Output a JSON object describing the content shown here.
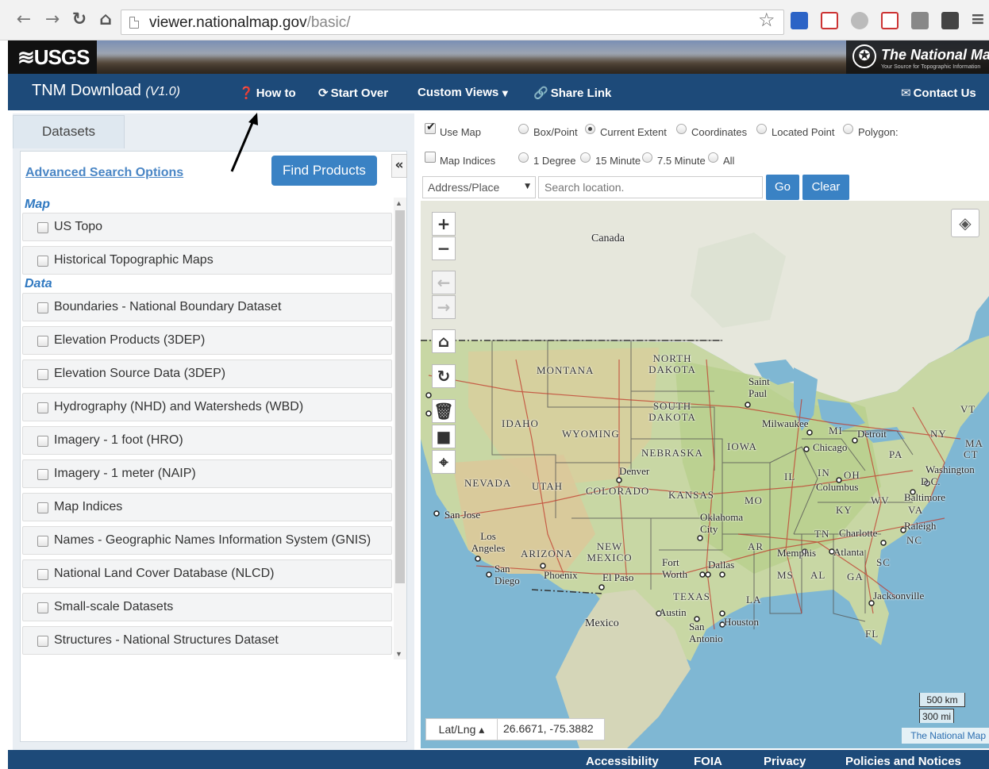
{
  "browser": {
    "url_host": "viewer.nationalmap.gov",
    "url_path": "/basic/"
  },
  "banner": {
    "usgs_logo": "≋USGS",
    "brand_title": "The National Map",
    "brand_tagline": "Your Source for Topographic Information"
  },
  "nav": {
    "app_title": "TNM Download",
    "app_version": "(V1.0)",
    "how_to": "How to",
    "start_over": "Start Over",
    "custom_views": "Custom Views",
    "share_link": "Share Link",
    "contact_us": "Contact Us"
  },
  "left": {
    "tab_label": "Datasets",
    "advanced_search": "Advanced Search Options",
    "find_products": "Find Products",
    "collapse_glyph": "«",
    "groups": [
      {
        "heading": "Map",
        "items": [
          "US Topo",
          "Historical Topographic Maps"
        ]
      },
      {
        "heading": "Data",
        "items": [
          "Boundaries - National Boundary Dataset",
          "Elevation Products (3DEP)",
          "Elevation Source Data (3DEP)",
          "Hydrography (NHD) and Watersheds (WBD)",
          "Imagery - 1 foot (HRO)",
          "Imagery - 1 meter (NAIP)",
          "Map Indices",
          "Names - Geographic Names Information System (GNIS)",
          "National Land Cover Database (NLCD)",
          "Small-scale Datasets",
          "Structures - National Structures Dataset"
        ]
      }
    ]
  },
  "toolbar": {
    "use_map": "Use Map",
    "box_point": "Box/Point",
    "current_extent": "Current Extent",
    "coordinates": "Coordinates",
    "located_point": "Located Point",
    "polygon": "Polygon:",
    "map_indices": "Map Indices",
    "one_degree": "1 Degree",
    "fifteen_minute": "15 Minute",
    "seven_five_minute": "7.5 Minute",
    "all": "All",
    "address_select": "Address/Place",
    "search_placeholder": "Search location.",
    "go": "Go",
    "clear": "Clear"
  },
  "map": {
    "labels": {
      "canada": "Canada",
      "montana": "MONTANA",
      "north_dakota": "NORTH DAKOTA",
      "south_dakota": "SOUTH DAKOTA",
      "idaho": "IDAHO",
      "wyoming": "WYOMING",
      "nebraska": "NEBRASKA",
      "iowa": "IOWA",
      "nevada": "NEVADA",
      "utah": "UTAH",
      "colorado": "COLORADO",
      "kansas": "KANSAS",
      "mo": "MO",
      "il": "IL",
      "in": "IN",
      "oh": "OH",
      "mi": "MI",
      "pa": "PA",
      "ny": "NY",
      "vt": "VT",
      "ma": "MA",
      "ct": "CT",
      "dc": "D.C.",
      "wv": "WV",
      "va": "VA",
      "ky": "KY",
      "tn": "TN",
      "nc": "NC",
      "sc": "SC",
      "ga": "GA",
      "al": "AL",
      "ms": "MS",
      "ar": "AR",
      "la": "LA",
      "fl": "FL",
      "arizona": "ARIZONA",
      "new_mexico": "NEW MEXICO",
      "texas": "TEXAS",
      "mexico": "Mexico",
      "saint_paul": "Saint Paul",
      "milwaukee": "Milwaukee",
      "chicago": "Chicago",
      "detroit": "Detroit",
      "denver": "Denver",
      "columbus": "Columbus",
      "washington": "Washington",
      "baltimore": "Baltimore",
      "raleigh": "Raleigh",
      "charlotte": "Charlotte",
      "atlanta": "Atlanta",
      "memphis": "Memphis",
      "oklahoma_city": "Oklahoma City",
      "dallas": "Dallas",
      "fort_worth": "Fort Worth",
      "austin": "Austin",
      "houston": "Houston",
      "san_antonio": "San Antonio",
      "jacksonville": "Jacksonville",
      "el_paso": "El Paso",
      "phoenix": "Phoenix",
      "san_diego": "San Diego",
      "los_angeles": "Los Angeles",
      "san_jose": "San Jose"
    },
    "coord_mode": "Lat/Lng ▴",
    "coord_value": "26.6671, -75.3882",
    "scale_km": "500 km",
    "scale_mi": "300 mi",
    "attribution": "The National Map"
  },
  "footer": {
    "accessibility": "Accessibility",
    "foia": "FOIA",
    "privacy": "Privacy",
    "policies": "Policies and Notices"
  }
}
